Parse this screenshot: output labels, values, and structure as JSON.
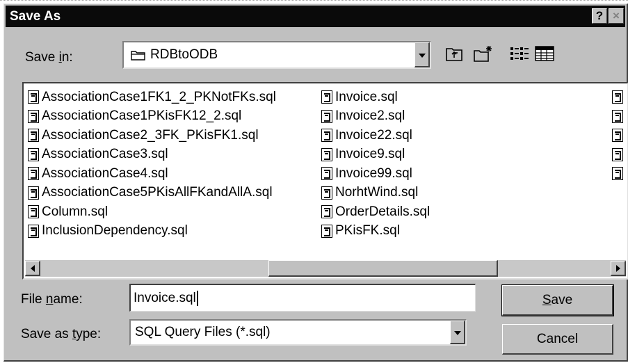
{
  "window": {
    "title": "Save As",
    "help_label": "?",
    "close_label": "×"
  },
  "save_in": {
    "label_prefix": "Save ",
    "label_accel": "i",
    "label_suffix": "n:",
    "value": "RDBtoODB"
  },
  "files": {
    "col1": [
      "AssociationCase1FK1_2_PKNotFKs.sql",
      "AssociationCase1PKisFK12_2.sql",
      "AssociationCase2_3FK_PKisFK1.sql",
      "AssociationCase3.sql",
      "AssociationCase4.sql",
      "AssociationCase5PKisAllFKandAllA.sql",
      "Column.sql",
      "InclusionDependency.sql"
    ],
    "col2": [
      "Invoice.sql",
      "Invoice2.sql",
      "Invoice22.sql",
      "Invoice9.sql",
      "Invoice99.sql",
      "NorhtWind.sql",
      "OrderDetails.sql",
      "PKisFK.sql"
    ]
  },
  "file_name": {
    "label_prefix": "File ",
    "label_accel": "n",
    "label_suffix": "ame:",
    "value": "Invoice.sql"
  },
  "save_as_type": {
    "label_prefix": "Save as ",
    "label_accel": "t",
    "label_suffix": "ype:",
    "value": "SQL Query Files (*.sql)"
  },
  "buttons": {
    "save_accel": "S",
    "save_rest": "ave",
    "cancel": "Cancel"
  }
}
